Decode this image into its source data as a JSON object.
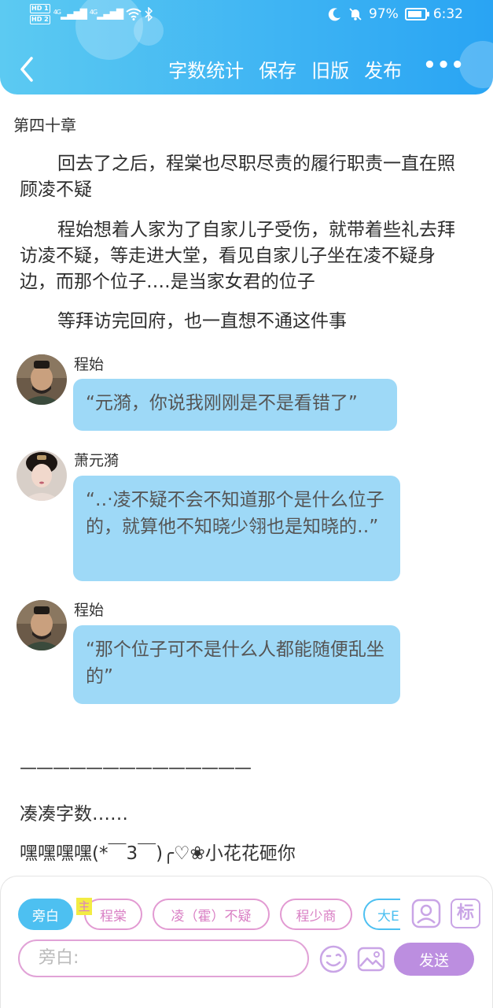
{
  "status_bar": {
    "hd1": "HD 1",
    "hd2": "HD 2",
    "signal1": "4G",
    "signal2": "4G",
    "battery": "97%",
    "time": "6:32"
  },
  "nav": {
    "word_count": "字数统计",
    "save": "保存",
    "old_version": "旧版",
    "publish": "发布",
    "more": "•••"
  },
  "content": {
    "chapter_title": "第四十章",
    "paragraphs": [
      "回去了之后，程棠也尽职尽责的履行职责一直在照顾凌不疑",
      "程始想着人家为了自家儿子受伤，就带着些礼去拜访凌不疑，等走进大堂，看见自家儿子坐在凌不疑身边，而那个位子‥‥是当家女君的位子",
      "等拜访完回府，也一直想不通这件事"
    ],
    "messages": [
      {
        "name": "程始",
        "text": "“元漪，你说我刚刚是不是看错了”"
      },
      {
        "name": "萧元漪",
        "text": "“‥‧凌不疑不会不知道那个是什么位子的，就算他不知晓少翎也是知晓的‥”"
      },
      {
        "name": "程始",
        "text": "“那个位子可不是什么人都能随便乱坐的”"
      }
    ],
    "divider": "——————————————",
    "filler": "凑凑字数……",
    "closing": "嘿嘿嘿嘿(*￣3￣)╭♡❀小花花砸你"
  },
  "composer": {
    "roles": [
      "旁白",
      "程棠",
      "凌（霍）不疑",
      "程少商",
      "大E"
    ],
    "main_tag": "主",
    "mark_label": "标",
    "input_placeholder": "旁白:",
    "send_label": "发送"
  },
  "colors": {
    "header_gradient_start": "#5ccaf2",
    "header_gradient_end": "#29a4f3",
    "bubble": "#9ed9f7",
    "role_active": "#4dc0f1",
    "role_pink": "#d97fc4",
    "send": "#bc8ee0"
  }
}
